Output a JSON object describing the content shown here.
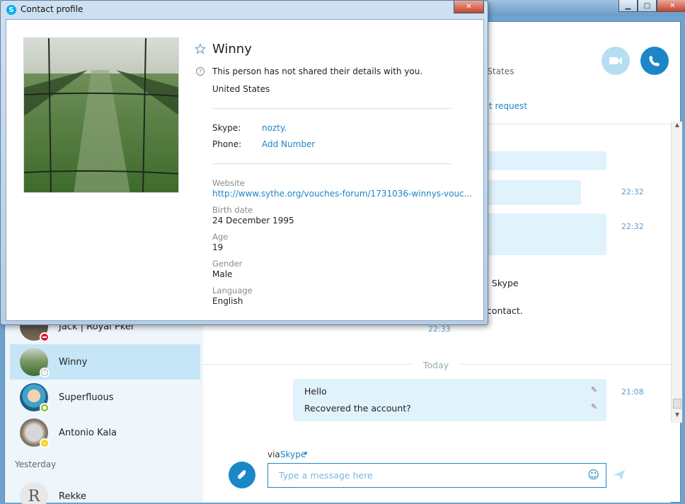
{
  "profile_window": {
    "title": "Contact profile",
    "name": "Winny",
    "privacy_note": "This person has not shared their details with you.",
    "country": "United States",
    "skype_label": "Skype:",
    "skype_value": "nozty.",
    "phone_label": "Phone:",
    "phone_value": "Add Number",
    "website_label": "Website",
    "website_value": "http://www.sythe.org/vouches-forum/1731036-winnys-vouc...",
    "birth_label": "Birth date",
    "birth_value": "24 December 1995",
    "age_label": "Age",
    "age_value": "19",
    "gender_label": "Gender",
    "gender_value": "Male",
    "language_label": "Language",
    "language_value": "English"
  },
  "conversation": {
    "header_location_partial": "d States",
    "contact_request_partial": "act request",
    "times": [
      "22:32",
      "22:32",
      "22:33",
      "21:08"
    ],
    "partial_text_1": "n Skype",
    "partial_text_2": "contact.",
    "day_separator": "Today",
    "messages": [
      {
        "text": "Hello"
      },
      {
        "text": "Recovered the account?"
      }
    ],
    "via_label": "via",
    "via_service": "Skype",
    "input_placeholder": "Type a message here"
  },
  "contacts": [
    {
      "name": "Jack | Royal Pker",
      "status": "busy"
    },
    {
      "name": "Winny",
      "status": "unknown"
    },
    {
      "name": "Superfluous",
      "status": "online"
    },
    {
      "name": "Antonio Kala",
      "status": "away"
    }
  ],
  "contacts_section": "Yesterday",
  "contacts_after": [
    {
      "name": "Rekke"
    }
  ],
  "colors": {
    "accent": "#1b86c8",
    "bubble": "#e0f2fc",
    "selected": "#c6e6f7"
  }
}
